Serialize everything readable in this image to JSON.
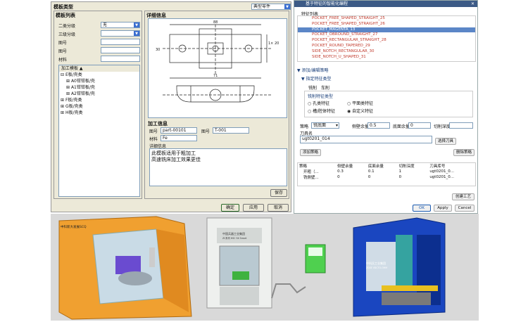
{
  "left_window": {
    "title": "模板类型",
    "template_type_value": "典型零件",
    "list_panel_title": "模板列表",
    "fields": [
      {
        "label": "二类分级",
        "value": "无"
      },
      {
        "label": "三级分级",
        "value": ""
      },
      {
        "label": "图号",
        "value": ""
      },
      {
        "label": "图号",
        "value": ""
      },
      {
        "label": "材料",
        "value": ""
      }
    ],
    "tree_header": "加工模板",
    "tree": [
      "E板/壳类",
      "A0钳钳板/壳",
      "A1钳钳板/壳",
      "A2钳钳板/壳",
      "F板/壳类",
      "G板/壳类",
      "H板/壳类"
    ],
    "detail_title": "详细信息",
    "dim_labels": {
      "top": "88",
      "right": "1× 20",
      "bottom": "71",
      "h1": "30"
    },
    "process_title": "加工信息",
    "drawing_no_label": "图号",
    "drawing_no_value": "part-00101",
    "fig_no_label": "图号",
    "fig_no_value": "T-001",
    "material_label": "材料",
    "material_value": "Fe",
    "detail_info_label": "详细信息",
    "detail_text_line1": "此模板适用于粗加工",
    "detail_text_line2": "高速铣床加工效果更佳",
    "save_label": "保存",
    "ok_label": "确定",
    "apply_label": "应用",
    "cancel_label": "取消"
  },
  "right_window": {
    "title": "基于特征的智能化编程",
    "feature_list_label": "特征列表",
    "features": [
      "POCKET_FREE_SHAPED_STRAIGHT_25",
      "POCKET_FREE_SHAPED_STRAIGHT_26",
      "POCKET_MAGENTA_13",
      "POCKET_OBROUND_STRAIGHT_27",
      "POCKET_RECTANGULAR_STRAIGHT_28",
      "POCKET_ROUND_TAPERED_29",
      "SIDE_NOTCH_RECTANGULAR_30",
      "SIDE_NOTCH_U_SHAPED_31"
    ],
    "selected_index": 2,
    "strategy_section": "添加/编辑策略",
    "sub_section": "指定特征类型",
    "tab_mill": "铣削",
    "tab_drill": "车削",
    "group_label": "铣削特征类型",
    "radios": [
      "孔类特征",
      "平面类特征",
      "槽/腔体特征",
      "自定义特征"
    ],
    "strategy_label": "策略",
    "strategy_value": "铣底面",
    "side_allow_label": "侧壁余量",
    "side_allow_value": "0.5",
    "floor_allow_label": "底面余量",
    "floor_allow_value": "0",
    "cut_depth_label": "切削深度",
    "cut_depth_value": "",
    "tool_label": "刀具名",
    "tool_value": "ugt0201_014",
    "select_tool_label": "选择刀具",
    "add_strategy_label": "添加策略",
    "delete_strategy_label": "删除策略",
    "table_headers": [
      "策略",
      "侧壁余量",
      "底面余量",
      "切削深度",
      "刀具库号"
    ],
    "table_rows": [
      [
        "开粗（...",
        "0.3",
        "0.1",
        "1",
        "ugt0201_0..."
      ],
      [
        "铣侧壁...",
        "0",
        "0",
        "0",
        "ugt0201_0..."
      ]
    ],
    "create_process_label": "创建工艺",
    "ok_label": "OK",
    "apply_label": "Apply",
    "cancel_label": "Cancel"
  },
  "machines": {
    "left_label_1": "中科新大发展SCQ",
    "mid_label_1": "中国兵器工业集团",
    "mid_label_2": "ZC系列 HSC 5X Smart",
    "right_label_1": "中科兵工业集团",
    "right_label_2": "ZGSE VDCTO-OHM"
  }
}
